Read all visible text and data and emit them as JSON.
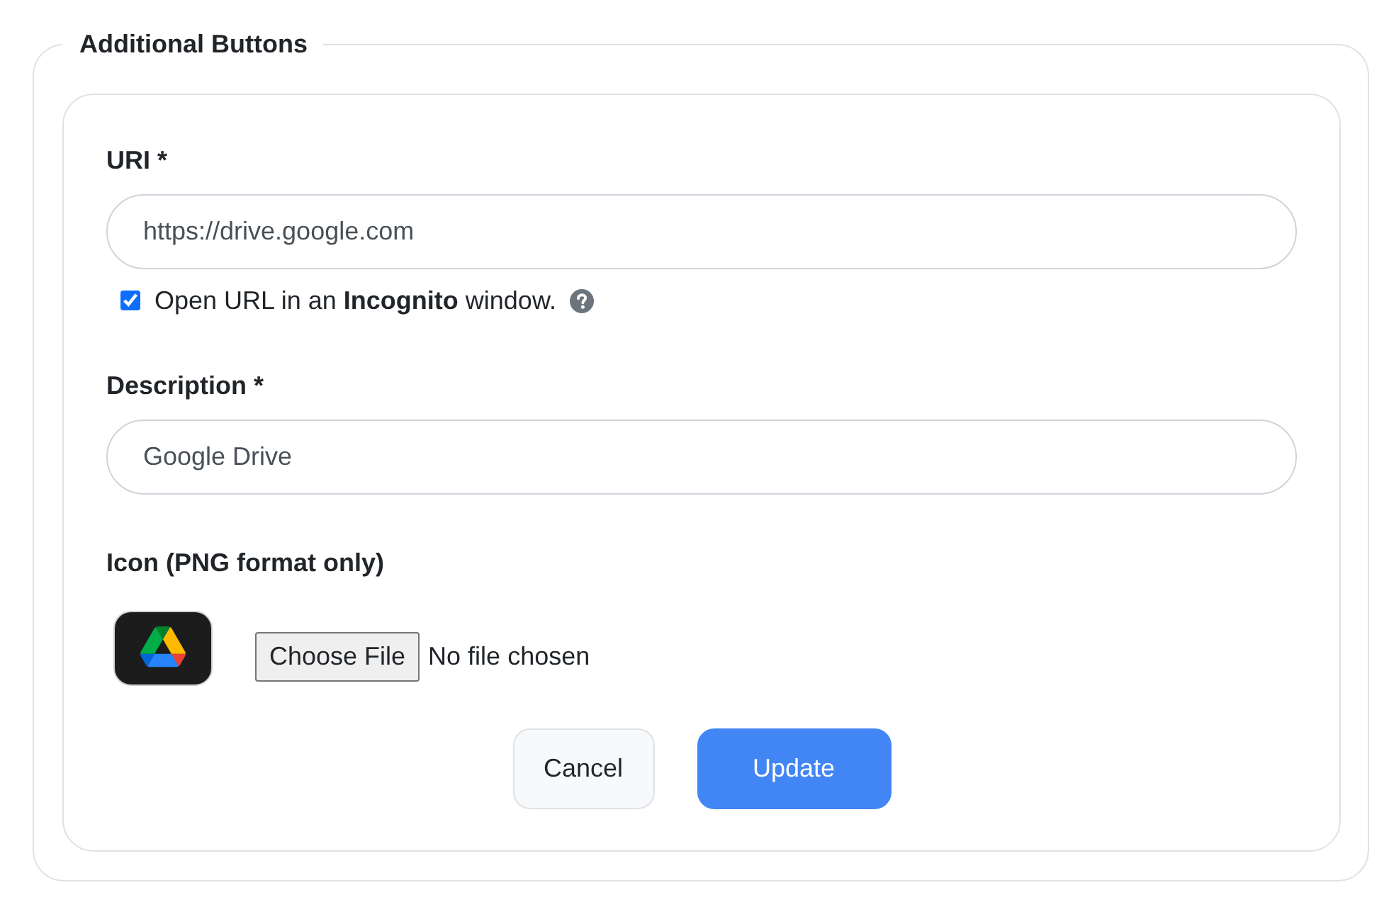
{
  "section": {
    "title": "Additional Buttons"
  },
  "uri": {
    "label": "URI *",
    "value": "https://drive.google.com"
  },
  "incognito": {
    "checked": true,
    "text": "Open URL in an **Incognito** window."
  },
  "description": {
    "label": "Description *",
    "value": "Google Drive"
  },
  "icon": {
    "label": "Icon (PNG format only)",
    "button": "Choose File",
    "status": "No file chosen"
  },
  "buttons": [
    {
      "label": "Cancel",
      "kind": "secondary"
    },
    {
      "label": "Update",
      "kind": "primary"
    }
  ]
}
